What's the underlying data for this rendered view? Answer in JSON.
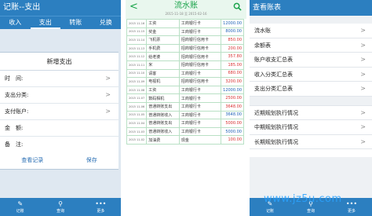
{
  "panel1": {
    "title": "记账--支出",
    "tabs": [
      "收入",
      "支出",
      "转账",
      "兑换"
    ],
    "card_title": "新增支出",
    "rows": [
      {
        "label": "时　间:",
        "chev": ">"
      },
      {
        "label": "支出分类:",
        "chev": ">"
      },
      {
        "label": "支付账户:",
        "chev": ">"
      },
      {
        "label": "金　额:",
        "chev": ""
      },
      {
        "label": "备　注:",
        "chev": ""
      }
    ],
    "view_records": "查看记录",
    "save": "保存",
    "bottom": [
      {
        "icon": "✎",
        "label": "记账"
      },
      {
        "icon": "⚲",
        "label": "查询"
      },
      {
        "icon": "•••",
        "label": "更多"
      }
    ]
  },
  "panel2": {
    "title": "流水账",
    "subtitle": "2015-11-18 至 2015-02-16",
    "rows": [
      {
        "date": "2015 11-16",
        "cat": "工资",
        "acct": "工商银行卡",
        "amt": "12000.00",
        "color": "blue"
      },
      {
        "date": "2015 11-15",
        "cat": "奖金",
        "acct": "工商银行卡",
        "amt": "8000.00",
        "color": "blue"
      },
      {
        "date": "2015 11-14",
        "cat": "飞机票",
        "acct": "招商银行信用卡",
        "amt": "850.00",
        "color": "red"
      },
      {
        "date": "2015 11-13",
        "cat": "手机费",
        "acct": "招商银行信用卡",
        "amt": "200.00",
        "color": "red"
      },
      {
        "date": "2015 11-12",
        "cat": "给老婆",
        "acct": "招商银行信用卡",
        "amt": "357.80",
        "color": "red"
      },
      {
        "date": "2015 11-11",
        "cat": "米",
        "acct": "招商银行信用卡",
        "amt": "185.00",
        "color": "red"
      },
      {
        "date": "2015 11-10",
        "cat": "请客",
        "acct": "工商银行卡",
        "amt": "680.00",
        "color": "red"
      },
      {
        "date": "2015 11-09",
        "cat": "电视机",
        "acct": "招商银行信用卡",
        "amt": "3200.00",
        "color": "red"
      },
      {
        "date": "2015 11-08",
        "cat": "工资",
        "acct": "工商银行卡",
        "amt": "12000.00",
        "color": "blue"
      },
      {
        "date": "2015 11-07",
        "cat": "数码相机",
        "acct": "工商银行卡",
        "amt": "2500.00",
        "color": "red"
      },
      {
        "date": "2015 11-06",
        "cat": "普通转账支出",
        "acct": "工商银行卡",
        "amt": "3648.00",
        "color": "red"
      },
      {
        "date": "2015 11-05",
        "cat": "普通转账收入",
        "acct": "工商银行卡",
        "amt": "3648.00",
        "color": "blue"
      },
      {
        "date": "2015 11-04",
        "cat": "普通转账支出",
        "acct": "工商银行卡",
        "amt": "5000.00",
        "color": "red"
      },
      {
        "date": "2015 11-03",
        "cat": "普通转账收入",
        "acct": "工商银行卡",
        "amt": "5000.00",
        "color": "blue"
      },
      {
        "date": "2015 11-02",
        "cat": "加油费",
        "acct": "现金",
        "amt": "100.00",
        "color": "red"
      }
    ]
  },
  "panel3": {
    "title": "查看账表",
    "group1": [
      "流水账",
      "余额表",
      "账户收支汇总表",
      "收入分类汇总表",
      "支出分类汇总表"
    ],
    "group2": [
      "近期规划执行情况",
      "中期规划执行情况",
      "长期规划执行情况"
    ],
    "chev": ">",
    "bottom": [
      {
        "icon": "✎",
        "label": "记账"
      },
      {
        "icon": "⚲",
        "label": "查询"
      },
      {
        "icon": "•••",
        "label": "更多"
      }
    ]
  },
  "watermark": "www.jz5u.com",
  "colors": {
    "blue_bar": "#2c7fc0",
    "green": "#1aa34a",
    "income": "#2163b8",
    "expense": "#d93030"
  }
}
